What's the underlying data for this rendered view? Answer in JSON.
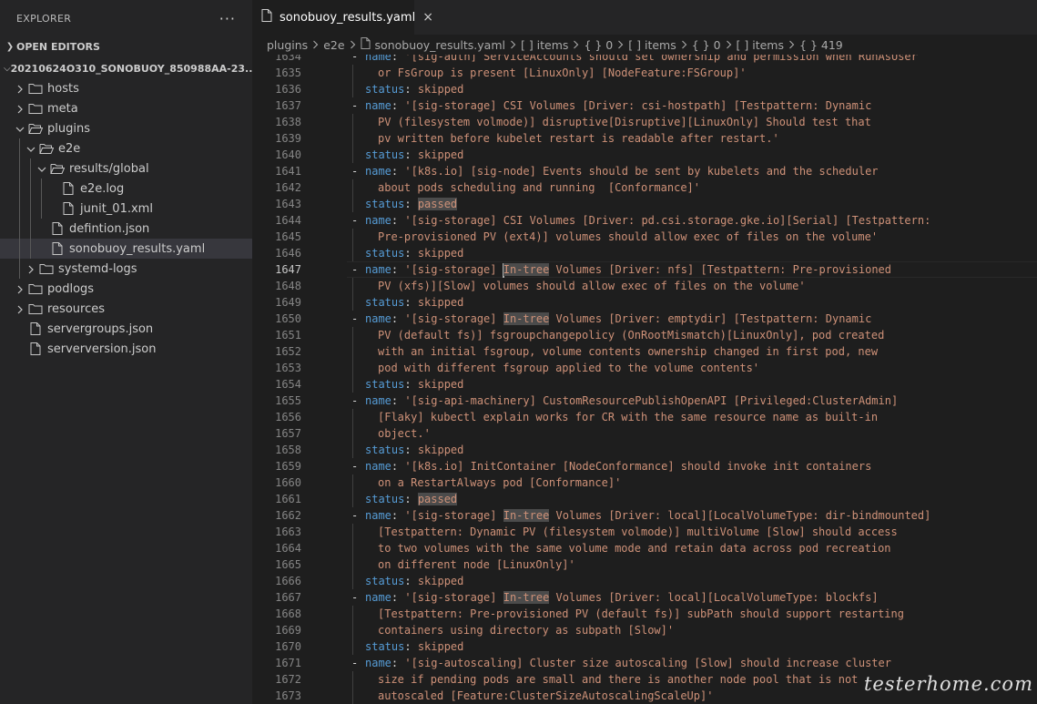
{
  "explorer": {
    "title": "EXPLORER",
    "more": "···",
    "open_editors": "OPEN EDITORS",
    "root": "20210624O310_SONOBUOY_850988AA-23...",
    "tree": [
      {
        "label": "hosts",
        "type": "folder",
        "depth": 0,
        "open": false
      },
      {
        "label": "meta",
        "type": "folder",
        "depth": 0,
        "open": false
      },
      {
        "label": "plugins",
        "type": "folder",
        "depth": 0,
        "open": true
      },
      {
        "label": "e2e",
        "type": "folder",
        "depth": 1,
        "open": true
      },
      {
        "label": "results/global",
        "type": "folder",
        "depth": 2,
        "open": true
      },
      {
        "label": "e2e.log",
        "type": "file",
        "depth": 3
      },
      {
        "label": "junit_01.xml",
        "type": "file",
        "depth": 3
      },
      {
        "label": "defintion.json",
        "type": "file",
        "depth": 2
      },
      {
        "label": "sonobuoy_results.yaml",
        "type": "file",
        "depth": 2,
        "selected": true
      },
      {
        "label": "systemd-logs",
        "type": "folder",
        "depth": 1,
        "open": false
      },
      {
        "label": "podlogs",
        "type": "folder",
        "depth": 0,
        "open": false
      },
      {
        "label": "resources",
        "type": "folder",
        "depth": 0,
        "open": false
      },
      {
        "label": "servergroups.json",
        "type": "file",
        "depth": 0
      },
      {
        "label": "serverversion.json",
        "type": "file",
        "depth": 0
      }
    ]
  },
  "tab": {
    "label": "sonobuoy_results.yaml",
    "close": "×"
  },
  "breadcrumb": [
    "plugins",
    "e2e",
    "sonobuoy_results.yaml",
    "[ ] items",
    "{ } 0",
    "[ ] items",
    "{ } 0",
    "[ ] items",
    "{ } 419"
  ],
  "editor": {
    "current_line": 1647,
    "caret_line": 1647,
    "caret_col": 15,
    "highlight_words": [
      "In-tree",
      "passed"
    ],
    "lines": [
      {
        "n": 1634,
        "dash": true,
        "key": "name",
        "text": "'[sig-auth] ServiceAccounts should set ownership and permission when RunAsUser"
      },
      {
        "n": 1635,
        "text": "or FsGroup is present [LinuxOnly] [NodeFeature:FSGroup]'"
      },
      {
        "n": 1636,
        "key": "status",
        "text": "skipped",
        "status": true
      },
      {
        "n": 1637,
        "dash": true,
        "key": "name",
        "text": "'[sig-storage] CSI Volumes [Driver: csi-hostpath] [Testpattern: Dynamic"
      },
      {
        "n": 1638,
        "text": "PV (filesystem volmode)] disruptive[Disruptive][LinuxOnly] Should test that"
      },
      {
        "n": 1639,
        "text": "pv written before kubelet restart is readable after restart.'"
      },
      {
        "n": 1640,
        "key": "status",
        "text": "skipped",
        "status": true
      },
      {
        "n": 1641,
        "dash": true,
        "key": "name",
        "text": "'[k8s.io] [sig-node] Events should be sent by kubelets and the scheduler"
      },
      {
        "n": 1642,
        "text": "about pods scheduling and running  [Conformance]'"
      },
      {
        "n": 1643,
        "key": "status",
        "text": "passed",
        "status": true
      },
      {
        "n": 1644,
        "dash": true,
        "key": "name",
        "text": "'[sig-storage] CSI Volumes [Driver: pd.csi.storage.gke.io][Serial] [Testpattern:"
      },
      {
        "n": 1645,
        "text": "Pre-provisioned PV (ext4)] volumes should allow exec of files on the volume'"
      },
      {
        "n": 1646,
        "key": "status",
        "text": "skipped",
        "status": true
      },
      {
        "n": 1647,
        "dash": true,
        "key": "name",
        "text": "'[sig-storage] In-tree Volumes [Driver: nfs] [Testpattern: Pre-provisioned"
      },
      {
        "n": 1648,
        "text": "PV (xfs)][Slow] volumes should allow exec of files on the volume'"
      },
      {
        "n": 1649,
        "key": "status",
        "text": "skipped",
        "status": true
      },
      {
        "n": 1650,
        "dash": true,
        "key": "name",
        "text": "'[sig-storage] In-tree Volumes [Driver: emptydir] [Testpattern: Dynamic"
      },
      {
        "n": 1651,
        "text": "PV (default fs)] fsgroupchangepolicy (OnRootMismatch)[LinuxOnly], pod created"
      },
      {
        "n": 1652,
        "text": "with an initial fsgroup, volume contents ownership changed in first pod, new"
      },
      {
        "n": 1653,
        "text": "pod with different fsgroup applied to the volume contents'"
      },
      {
        "n": 1654,
        "key": "status",
        "text": "skipped",
        "status": true
      },
      {
        "n": 1655,
        "dash": true,
        "key": "name",
        "text": "'[sig-api-machinery] CustomResourcePublishOpenAPI [Privileged:ClusterAdmin]"
      },
      {
        "n": 1656,
        "text": "[Flaky] kubectl explain works for CR with the same resource name as built-in"
      },
      {
        "n": 1657,
        "text": "object.'"
      },
      {
        "n": 1658,
        "key": "status",
        "text": "skipped",
        "status": true
      },
      {
        "n": 1659,
        "dash": true,
        "key": "name",
        "text": "'[k8s.io] InitContainer [NodeConformance] should invoke init containers"
      },
      {
        "n": 1660,
        "text": "on a RestartAlways pod [Conformance]'"
      },
      {
        "n": 1661,
        "key": "status",
        "text": "passed",
        "status": true
      },
      {
        "n": 1662,
        "dash": true,
        "key": "name",
        "text": "'[sig-storage] In-tree Volumes [Driver: local][LocalVolumeType: dir-bindmounted]"
      },
      {
        "n": 1663,
        "text": "[Testpattern: Dynamic PV (filesystem volmode)] multiVolume [Slow] should access"
      },
      {
        "n": 1664,
        "text": "to two volumes with the same volume mode and retain data across pod recreation"
      },
      {
        "n": 1665,
        "text": "on different node [LinuxOnly]'"
      },
      {
        "n": 1666,
        "key": "status",
        "text": "skipped",
        "status": true
      },
      {
        "n": 1667,
        "dash": true,
        "key": "name",
        "text": "'[sig-storage] In-tree Volumes [Driver: local][LocalVolumeType: blockfs]"
      },
      {
        "n": 1668,
        "text": "[Testpattern: Pre-provisioned PV (default fs)] subPath should support restarting"
      },
      {
        "n": 1669,
        "text": "containers using directory as subpath [Slow]'"
      },
      {
        "n": 1670,
        "key": "status",
        "text": "skipped",
        "status": true
      },
      {
        "n": 1671,
        "dash": true,
        "key": "name",
        "text": "'[sig-autoscaling] Cluster size autoscaling [Slow] should increase cluster"
      },
      {
        "n": 1672,
        "text": "size if pending pods are small and there is another node pool that is not"
      },
      {
        "n": 1673,
        "text": "autoscaled [Feature:ClusterSizeAutoscalingScaleUp]'"
      }
    ]
  },
  "watermark": "testerhome.com"
}
